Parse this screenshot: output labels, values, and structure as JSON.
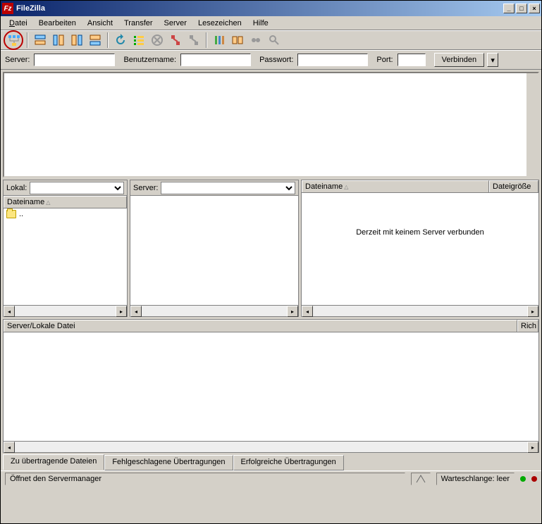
{
  "title": "FileZilla",
  "menu": {
    "file": "Datei",
    "edit": "Bearbeiten",
    "view": "Ansicht",
    "transfer": "Transfer",
    "server": "Server",
    "bookmarks": "Lesezeichen",
    "help": "Hilfe"
  },
  "quickconnect": {
    "server_label": "Server:",
    "server": "",
    "user_label": "Benutzername:",
    "user": "",
    "pass_label": "Passwort:",
    "pass": "",
    "port_label": "Port:",
    "port": "",
    "connect_btn": "Verbinden"
  },
  "local": {
    "label": "Lokal:",
    "path": "",
    "col_filename": "Dateiname",
    "parent_dir": ".."
  },
  "remote_tree": {
    "label": "Server:",
    "path": ""
  },
  "remote_list": {
    "col_filename": "Dateiname",
    "col_filesize": "Dateigröße",
    "empty_msg": "Derzeit mit keinem Server verbunden"
  },
  "queue": {
    "col_server_local": "Server/Lokale Datei",
    "col_direction": "Rich"
  },
  "tabs": {
    "queued": "Zu übertragende Dateien",
    "failed": "Fehlgeschlagene Übertragungen",
    "successful": "Erfolgreiche Übertragungen"
  },
  "status": {
    "hint": "Öffnet den Servermanager",
    "queue": "Warteschlange: leer"
  }
}
